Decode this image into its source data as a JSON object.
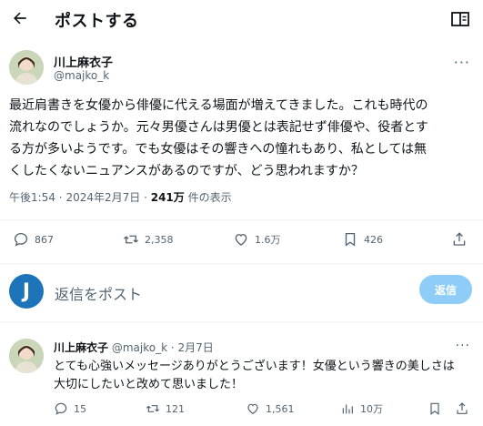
{
  "header": {
    "back_icon": "arrow-left-icon",
    "title": "ポストする",
    "reader_icon": "reader-mode-icon"
  },
  "post": {
    "author_name": "川上麻衣子",
    "author_handle": "@majko_k",
    "more_icon": "more-dots-icon",
    "text_lines": [
      "最近肩書きを女優から俳優に代える場面が増えてきました。これも時代の",
      "流れなのでしょうか。元々男優さんは男優とは表記せず俳優や、役者とす",
      "る方が多いようです。でも女優はその響きへの憧れもあり、私としては無",
      "くしたくないニュアンスがあるのですが、どう思われますか？"
    ],
    "time": "午後1:54",
    "date": "2024年2月7日",
    "separator": "·",
    "views_count": "241万",
    "views_label": "件の表示"
  },
  "actions": {
    "replies": "867",
    "reposts": "2,358",
    "likes": "1.6万",
    "bookmarks": "426"
  },
  "reply_box": {
    "avatar_letter": "J",
    "placeholder": "返信をポスト",
    "submit_label": "返信"
  },
  "reply_tweet": {
    "author_name": "川上麻衣子",
    "author_handle": "@majko_k",
    "separator": "·",
    "date": "2月7日",
    "text_lines": [
      "とても心強いメッセージありがとうございます！女優という響きの美しさは",
      "大切にしたいと改めて思いました！"
    ],
    "replies": "15",
    "reposts": "121",
    "likes": "1,561",
    "views": "10万"
  },
  "colors": {
    "text": "#0f1419",
    "muted": "#536471",
    "divider": "#eff3f4",
    "reply_button_bg": "#8ecdf7",
    "reply_avatar_bg": "#1d74b8"
  }
}
